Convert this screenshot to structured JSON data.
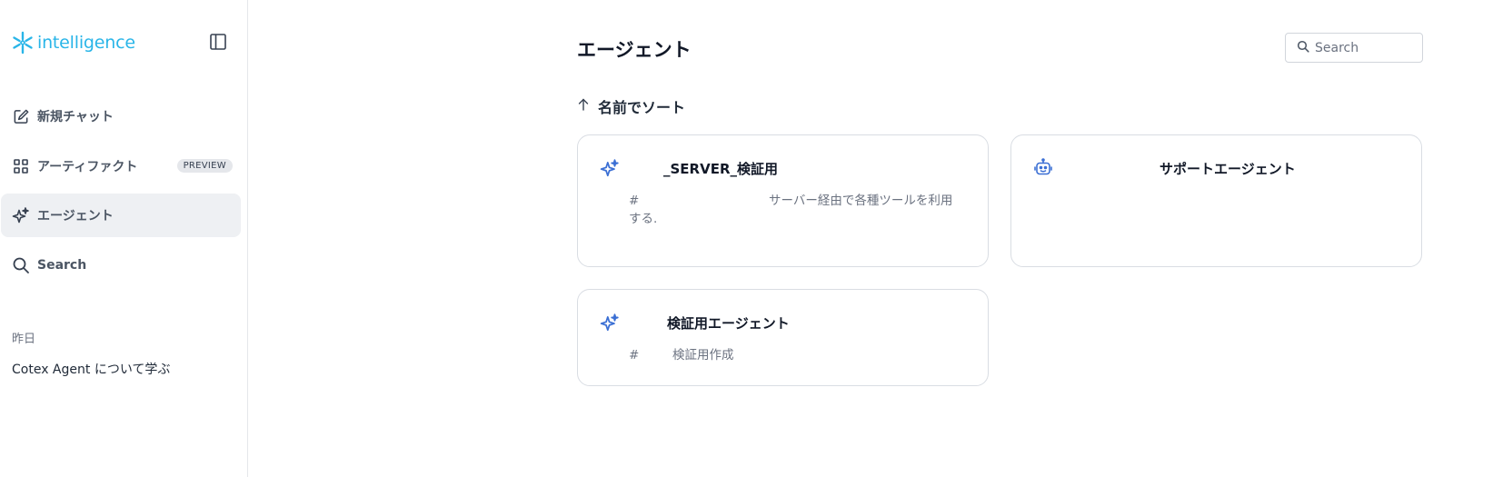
{
  "brand": {
    "name": "intelligence",
    "logo_icon": "snowflake-icon",
    "accent_color": "#29b5e8"
  },
  "sidebar": {
    "items": [
      {
        "label": "新規チャット",
        "icon": "edit-square-icon"
      },
      {
        "label": "アーティファクト",
        "icon": "grid-icon",
        "badge": "PREVIEW"
      },
      {
        "label": "エージェント",
        "icon": "sparkle-icon",
        "active": true
      },
      {
        "label": "Search",
        "icon": "search-icon"
      }
    ],
    "history_heading": "昨日",
    "history": [
      "Cotex Agent について学ぶ"
    ]
  },
  "main": {
    "title": "エージェント",
    "search_placeholder": "Search",
    "sort_label": "名前でソート",
    "agents": [
      {
        "icon": "sparkle-icon",
        "name": "_SERVER_検証用",
        "hash": "#",
        "description": "サーバー経由で各種ツールを利用する."
      },
      {
        "icon": "robot-icon",
        "name": "サポートエージェント",
        "hash": "",
        "description": ""
      },
      {
        "icon": "sparkle-icon",
        "name": "検証用エージェント",
        "hash": "#",
        "description": "検証用作成"
      }
    ]
  },
  "colors": {
    "icon_blue": "#3b6fd4",
    "active_bg": "#eef0f3",
    "border": "#d9dde3"
  }
}
